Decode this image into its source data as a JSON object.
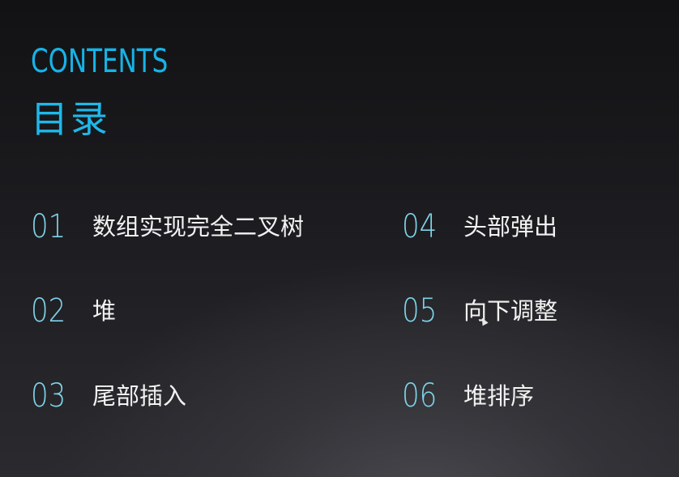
{
  "header": {
    "title_en": "CONTENTS",
    "title_zh": "目录"
  },
  "items": [
    {
      "number": "01",
      "label": "数组实现完全二叉树"
    },
    {
      "number": "02",
      "label": "堆"
    },
    {
      "number": "03",
      "label": "尾部插入"
    },
    {
      "number": "04",
      "label": "头部弹出"
    },
    {
      "number": "05",
      "label": "向下调整"
    },
    {
      "number": "06",
      "label": "堆排序"
    }
  ],
  "colors": {
    "heading": "#1eb8ea",
    "number": "#7fd3e8",
    "label": "#f2f2f2"
  }
}
